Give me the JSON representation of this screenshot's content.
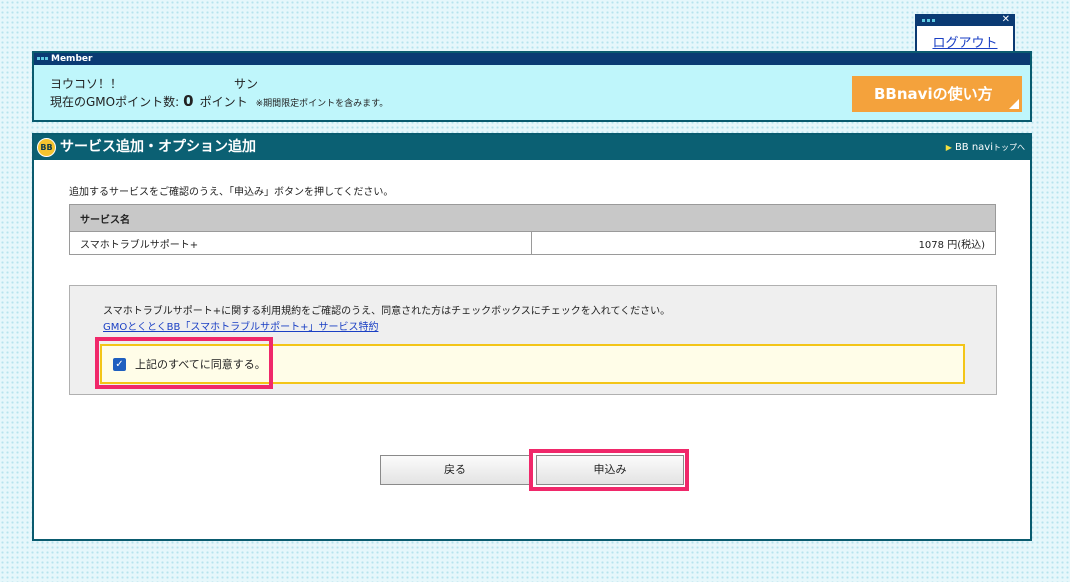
{
  "logout": {
    "label": "ログアウト"
  },
  "member": {
    "header": "Member",
    "welcome": "ヨウコソ！！",
    "san": "サン",
    "points_label": "現在のGMOポイント数:",
    "points_value": "0",
    "points_unit": "ポイント",
    "points_note": "※期間限定ポイントを含みます。",
    "bbnavi_button": "BBnaviの使い方"
  },
  "main": {
    "title": "サービス追加・オプション追加",
    "logo_text": "BB",
    "top_link": "BB navi",
    "top_link_suffix": "トップへ",
    "instruction": "追加するサービスをご確認のうえ、「申込み」ボタンを押してください。",
    "table": {
      "header": "サービス名",
      "rows": [
        {
          "name": "スマホトラブルサポート+",
          "price": "1078 円(税込)"
        }
      ]
    },
    "agreement": {
      "text": "スマホトラブルサポート+に関する利用規約をご確認のうえ、同意された方はチェックボックスにチェックを入れてください。",
      "link": "GMOとくとくBB「スマホトラブルサポート+」サービス特約",
      "checkbox_label": "上記のすべてに同意する。",
      "checked": true
    },
    "buttons": {
      "back": "戻る",
      "apply": "申込み"
    }
  }
}
